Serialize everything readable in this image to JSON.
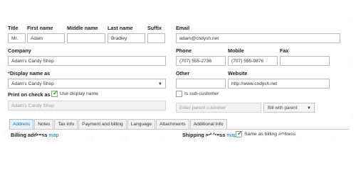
{
  "labels": {
    "title": "Title",
    "first_name": "First name",
    "middle_name": "Middle name",
    "last_name": "Last name",
    "suffix": "Suffix",
    "email": "Email",
    "company": "Company",
    "phone": "Phone",
    "mobile": "Mobile",
    "fax": "Fax",
    "display_name": "Display name as",
    "other": "Other",
    "website": "Website",
    "print_on_check": "Print on check as",
    "billing_address": "Billing address",
    "shipping_address": "Shipping address"
  },
  "values": {
    "title": "Mr.",
    "first_name": "Adam",
    "middle_name": "",
    "last_name": "Bradley",
    "suffix": "",
    "email": "adam@cndysh.net",
    "company": "Adam's Candy Shop",
    "phone": "(707) 555-2736",
    "mobile": "(707) 555-9876",
    "fax": "",
    "display_name": "Adam's Candy Shop",
    "other": "",
    "website": "http://www.cndysh.net",
    "print_on_check": "Adam's Candy Shop"
  },
  "checkboxes": {
    "use_display_name": {
      "label": "Use display name",
      "checked": true
    },
    "is_sub_customer": {
      "label": "Is sub-customer",
      "checked": false
    },
    "same_as_billing": {
      "label": "Same as billing address",
      "checked": true
    }
  },
  "parent_customer_placeholder": "Enter parent customer",
  "bill_with_parent": "Bill with parent",
  "required_marker": "*",
  "map_link": "map",
  "tabs": [
    {
      "label": "Address",
      "active": true
    },
    {
      "label": "Notes",
      "active": false
    },
    {
      "label": "Tax info",
      "active": false
    },
    {
      "label": "Payment and billing",
      "active": false
    },
    {
      "label": "Language",
      "active": false
    },
    {
      "label": "Attachments",
      "active": false
    },
    {
      "label": "Additional Info",
      "active": false
    }
  ],
  "colors": {
    "accent": "#0077c5",
    "check": "#2ca01c",
    "required": "#d52b1e"
  }
}
